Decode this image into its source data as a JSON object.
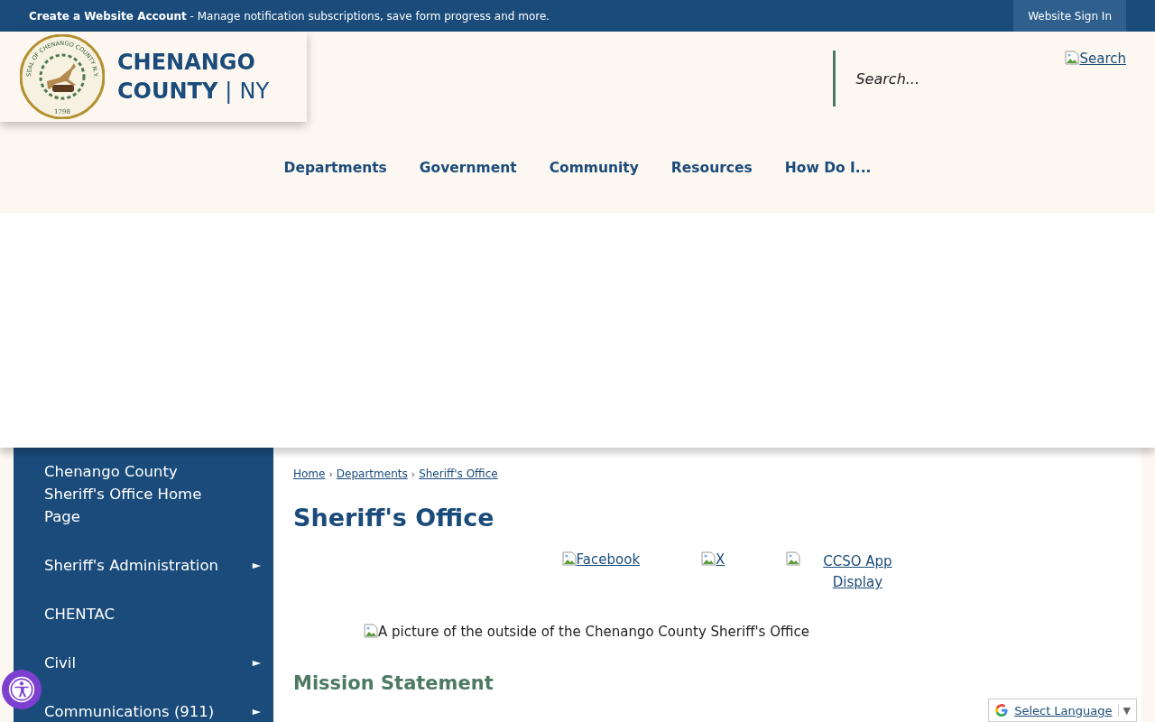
{
  "top_bar": {
    "account_link": "Create a Website Account",
    "account_text": " - Manage notification subscriptions, save form progress and more.",
    "sign_in": "Website Sign In"
  },
  "logo": {
    "seal_ring": "SEAL OF CHENANGO COUNTY N.Y.",
    "seal_year": "1798",
    "line_1": "CHENANGO",
    "line_2": "COUNTY",
    "divider": "|",
    "line_2_suffix": "NY"
  },
  "search": {
    "placeholder": "Search...",
    "button_alt": "Search"
  },
  "nav": [
    {
      "label": "Departments"
    },
    {
      "label": "Government"
    },
    {
      "label": "Community"
    },
    {
      "label": "Resources"
    },
    {
      "label": "How Do I..."
    }
  ],
  "sidebar": {
    "items": [
      {
        "label": "Chenango County Sheriff's Office Home Page"
      },
      {
        "label": "Sheriff's Administration",
        "arrow": "►"
      },
      {
        "label": "CHENTAC"
      },
      {
        "label": "Civil",
        "arrow": "►"
      },
      {
        "label": "Communications (911)",
        "arrow": "►"
      }
    ]
  },
  "breadcrumbs": [
    "Home",
    "Departments",
    "Sheriff's Office"
  ],
  "breadcrumb_separators": [
    "›",
    "›"
  ],
  "title": "Sheriff's Office",
  "social_links": [
    {
      "alt": "Facebook"
    },
    {
      "alt": "X"
    },
    {
      "alt": "CCSO App Display"
    }
  ],
  "photo_alt": "A picture of the outside of the Chenango County Sheriff's Office",
  "section_heading": "Mission Statement",
  "translate": {
    "label": "Select Language",
    "caret": "▼"
  }
}
